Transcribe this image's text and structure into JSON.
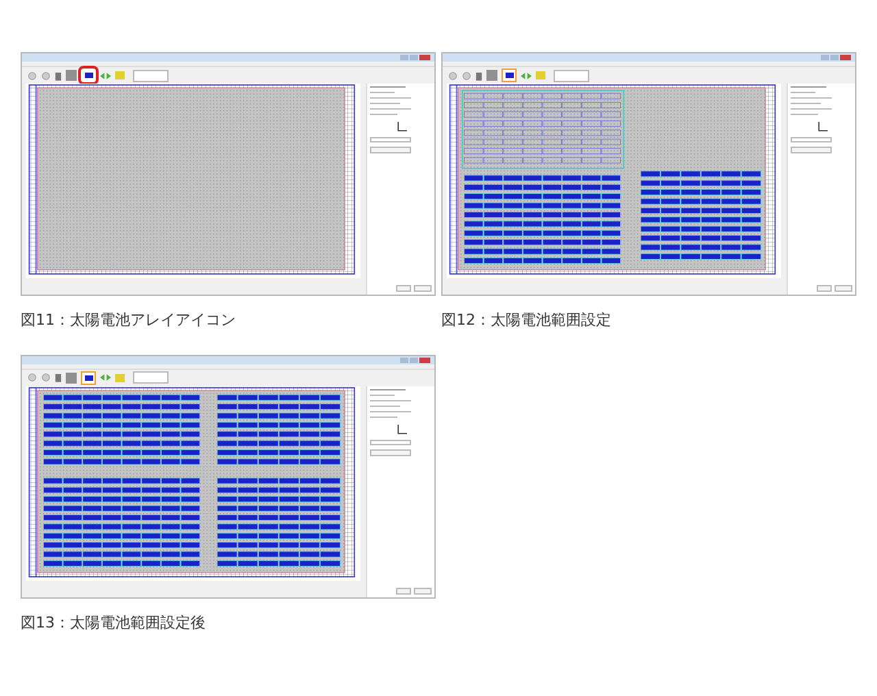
{
  "figures": [
    {
      "caption": "図11：太陽電池アレイアイコン",
      "kind": "empty",
      "tool_highlighted": true,
      "tool_selected": false
    },
    {
      "caption": "図12：太陽電池範囲設定",
      "kind": "selecting",
      "tool_highlighted": false,
      "tool_selected": true
    },
    {
      "caption": "図13：太陽電池範囲設定後",
      "kind": "filled",
      "tool_highlighted": false,
      "tool_selected": true
    }
  ]
}
